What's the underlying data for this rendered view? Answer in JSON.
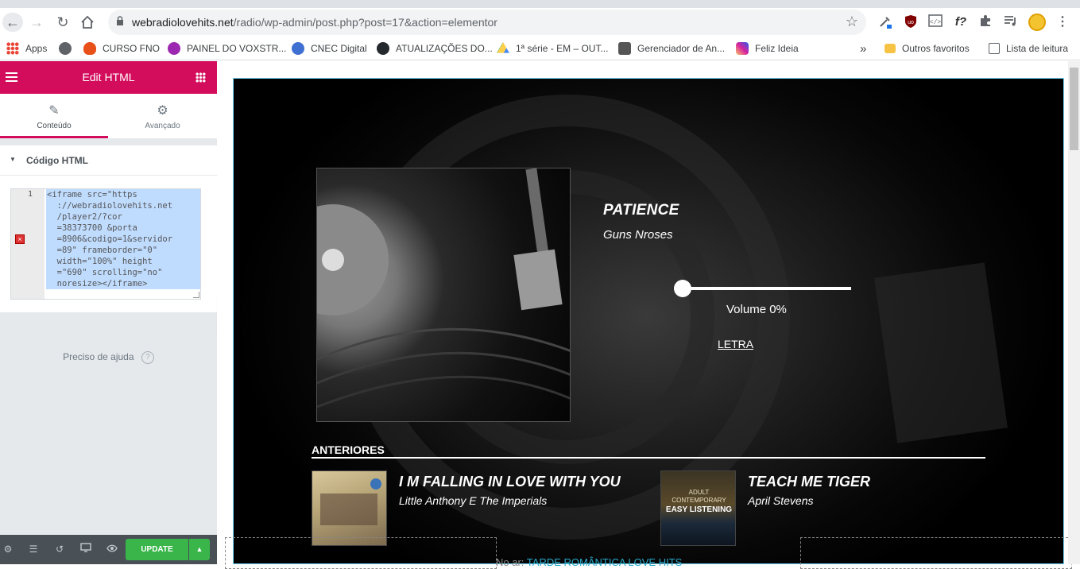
{
  "browser": {
    "url_host": "webradiolovehits.net",
    "url_path": "/radio/wp-admin/post.php?post=17&action=elementor"
  },
  "bookmarks": [
    {
      "label": "Apps",
      "icon": "apps-grid-icon",
      "color": "#ea4335"
    },
    {
      "label": "",
      "icon": "globe-icon",
      "color": "#5f6368"
    },
    {
      "label": "CURSO FNO",
      "icon": "flame-icon",
      "color": "#e8501a"
    },
    {
      "label": "PAINEL DO VOXSTR...",
      "icon": "oi-icon",
      "color": "#9c27b0"
    },
    {
      "label": "CNEC Digital",
      "icon": "cnec-icon",
      "color": "#3f6fd1"
    },
    {
      "label": "ATUALIZAÇÕES DO...",
      "icon": "github-icon",
      "color": "#24292e"
    },
    {
      "label": "1ª série - EM – OUT...",
      "icon": "drive-icon",
      "color": "#1fa463"
    },
    {
      "label": "Gerenciador de An...",
      "icon": "manager-icon",
      "color": "#555555"
    },
    {
      "label": "Feliz Ideia",
      "icon": "instagram-icon",
      "color": "#d6249f"
    }
  ],
  "bookmarks_right": {
    "more": "»",
    "others": "Outros favoritos",
    "reading_list": "Lista de leitura"
  },
  "panel": {
    "header_title": "Edit HTML",
    "tabs": [
      "Conteúdo",
      "Avançado"
    ],
    "section_title": "Código HTML",
    "line_number": "1",
    "code_lines": [
      "<iframe src=\"https",
      "  ://webradiolovehits.net",
      "  /player2/?cor",
      "  =38373700 &porta",
      "  =8906&codigo=1&servidor",
      "  =89\" frameborder=\"0\"",
      "  width=\"100%\" height",
      "  =\"690\" scrolling=\"no\"",
      "  noresize></iframe>"
    ],
    "help_text": "Preciso de ajuda",
    "update_label": "UPDATE"
  },
  "player": {
    "now": {
      "title": "PATIENCE",
      "artist": "Guns Nroses"
    },
    "volume_label": "Volume 0%",
    "volume_level": 0,
    "lyrics_link": "LETRA",
    "previous_heading": "ANTERIORES",
    "previous": [
      {
        "title": "I M FALLING IN LOVE WITH YOU",
        "artist": "Little Anthony E The Imperials"
      },
      {
        "title": "TEACH ME TIGER",
        "artist": "April Stevens"
      }
    ],
    "thumb2_text": [
      "ADULT",
      "CONTEMPORARY",
      "EASY LISTENING"
    ],
    "on_air_label": "No ar:",
    "on_air_show": "TARDE ROMÂNTICA LOVE HITS"
  },
  "colors": {
    "elementor_pink": "#d30c5c",
    "update_green": "#39b54a",
    "player_border": "#71d7f7",
    "on_air_accent": "#2aa8c8"
  }
}
